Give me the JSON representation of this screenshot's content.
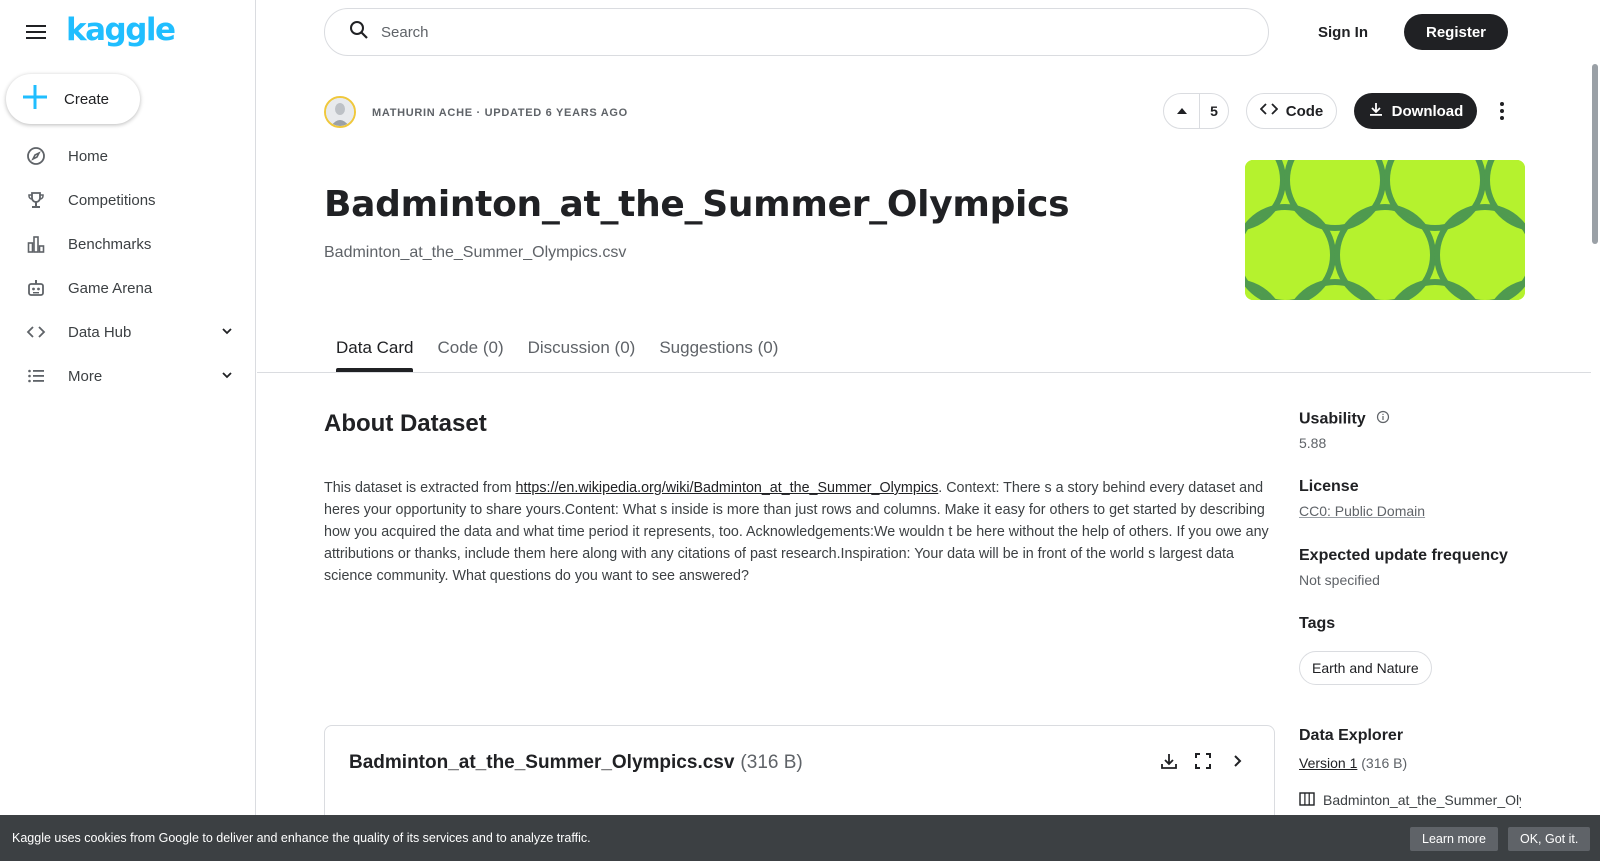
{
  "brand": {
    "logo": "kaggle",
    "accent": "#20beff",
    "dark": "#202124"
  },
  "sidebar": {
    "create_label": "Create",
    "items": [
      {
        "label": "Home",
        "icon": "compass-icon"
      },
      {
        "label": "Competitions",
        "icon": "trophy-icon"
      },
      {
        "label": "Benchmarks",
        "icon": "bar-chart-icon"
      },
      {
        "label": "Game Arena",
        "icon": "robot-icon"
      },
      {
        "label": "Data Hub",
        "icon": "code-brackets-icon",
        "expandable": true
      },
      {
        "label": "More",
        "icon": "list-icon",
        "expandable": true
      }
    ]
  },
  "header": {
    "search_placeholder": "Search",
    "sign_in": "Sign In",
    "register": "Register"
  },
  "dataset": {
    "author_line": "MATHURIN ACHE · UPDATED 6 YEARS AGO",
    "votes": "5",
    "code_label": "Code",
    "download_label": "Download",
    "title": "Badminton_at_the_Summer_Olympics",
    "subtitle": "Badminton_at_the_Summer_Olympics.csv",
    "banner_color": "#b5f22e"
  },
  "tabs": [
    {
      "label": "Data Card",
      "active": true
    },
    {
      "label": "Code (0)"
    },
    {
      "label": "Discussion (0)"
    },
    {
      "label": "Suggestions (0)"
    }
  ],
  "about": {
    "heading": "About Dataset",
    "text_before_link": "This dataset is extracted from ",
    "link": "https://en.wikipedia.org/wiki/Badminton_at_the_Summer_Olympics",
    "text_after_link": ". Context: There s a story behind every dataset and heres your opportunity to share yours.Content: What s inside is more than just rows and columns. Make it easy for others to get started by describing how you acquired the data and what time period it represents, too. Acknowledgements:We wouldn t be here without the help of others. If you owe any attributions or thanks, include them here along with any citations of past research.Inspiration: Your data will be in front of the world s largest data science community. What questions do you want to see answered?"
  },
  "sidebar_right": {
    "usability_label": "Usability",
    "usability_value": "5.88",
    "license_label": "License",
    "license_value": "CC0: Public Domain",
    "update_label": "Expected update frequency",
    "update_value": "Not specified",
    "tags_label": "Tags",
    "tags": [
      "Earth and Nature"
    ],
    "explorer_label": "Data Explorer",
    "version_link": "Version 1",
    "version_size": "(316 B)",
    "explorer_file": "Badminton_at_the_Summer_Olympics.csv"
  },
  "file_card": {
    "name": "Badminton_at_the_Summer_Olympics.csv",
    "size": "(316 B)"
  },
  "cookie": {
    "message": "Kaggle uses cookies from Google to deliver and enhance the quality of its services and to analyze traffic.",
    "learn_more": "Learn more",
    "ok": "OK, Got it."
  }
}
